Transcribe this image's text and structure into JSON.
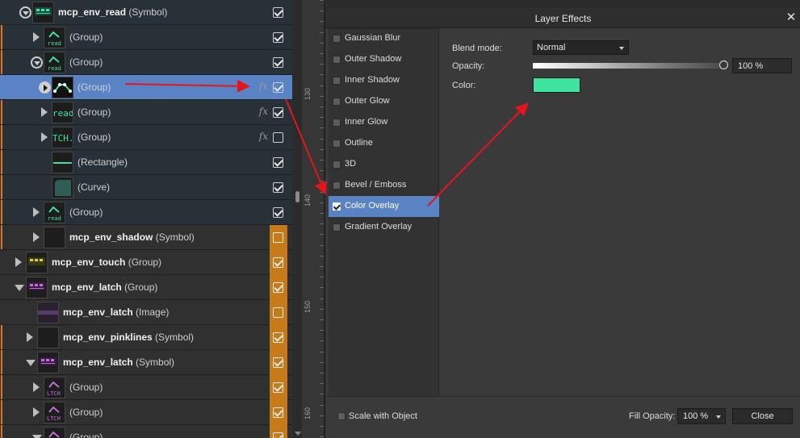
{
  "colors": {
    "accent": "#5a83c6",
    "orange": "#c77a1a",
    "overlay_color": "#3ee3a0",
    "arrow": "#e4161c"
  },
  "layers": [
    {
      "name": "mcp_env_read",
      "type": "(Symbol)",
      "bold": true,
      "expand": "circle-down",
      "checked": true,
      "fx": false,
      "indent": 24,
      "thumb": "read-symbol",
      "vis_orange": false,
      "bar": false
    },
    {
      "name": "",
      "type": "(Group)",
      "bold": false,
      "expand": "right",
      "checked": true,
      "fx": false,
      "indent": 38,
      "thumb": "read-icon",
      "vis_orange": false,
      "bar": true
    },
    {
      "name": "",
      "type": "(Group)",
      "bold": false,
      "expand": "circle-down",
      "checked": true,
      "fx": false,
      "indent": 38,
      "thumb": "read-icon",
      "vis_orange": false,
      "bar": true
    },
    {
      "name": "",
      "type": "(Group)",
      "bold": false,
      "expand": "circle-play",
      "checked": true,
      "fx": true,
      "indent": 48,
      "thumb": "caret-shape",
      "vis_orange": false,
      "bar": false,
      "selected": true
    },
    {
      "name": "",
      "type": "(Group)",
      "bold": false,
      "expand": "right",
      "checked": true,
      "fx": true,
      "indent": 48,
      "thumb": "read-text",
      "vis_orange": false,
      "bar": true
    },
    {
      "name": "",
      "type": "(Group)",
      "bold": false,
      "expand": "right",
      "checked": false,
      "fx": true,
      "indent": 48,
      "thumb": "tch-text",
      "vis_orange": false,
      "bar": true
    },
    {
      "name": "",
      "type": "(Rectangle)",
      "bold": false,
      "expand": "none",
      "checked": true,
      "fx": false,
      "indent": 48,
      "thumb": "line",
      "vis_orange": false,
      "bar": true
    },
    {
      "name": "",
      "type": "(Curve)",
      "bold": false,
      "expand": "none",
      "checked": true,
      "fx": false,
      "indent": 48,
      "thumb": "curve",
      "vis_orange": false,
      "bar": true
    },
    {
      "name": "",
      "type": "(Group)",
      "bold": false,
      "expand": "right",
      "checked": true,
      "fx": false,
      "indent": 38,
      "thumb": "read-icon",
      "vis_orange": false,
      "bar": true
    },
    {
      "name": "mcp_env_shadow",
      "type": "(Symbol)",
      "bold": true,
      "expand": "right",
      "checked": false,
      "fx": false,
      "indent": 38,
      "thumb": "blank",
      "vis_orange": true,
      "bar": true
    },
    {
      "name": "mcp_env_touch",
      "type": "(Group)",
      "bold": true,
      "expand": "right",
      "checked": true,
      "fx": false,
      "indent": 16,
      "thumb": "touch",
      "vis_orange": true,
      "bar": false
    },
    {
      "name": "mcp_env_latch",
      "type": "(Group)",
      "bold": true,
      "expand": "down",
      "checked": true,
      "fx": false,
      "indent": 16,
      "thumb": "latch",
      "vis_orange": true,
      "bar": false
    },
    {
      "name": "mcp_env_latch",
      "type": "(Image)",
      "bold": true,
      "expand": "none",
      "checked": false,
      "fx": false,
      "indent": 30,
      "thumb": "latch-image",
      "vis_orange": true,
      "bar": false
    },
    {
      "name": "mcp_env_pinklines",
      "type": "(Symbol)",
      "bold": true,
      "expand": "right",
      "checked": true,
      "fx": false,
      "indent": 30,
      "thumb": "blank",
      "vis_orange": true,
      "bar": true
    },
    {
      "name": "mcp_env_latch",
      "type": "(Symbol)",
      "bold": true,
      "expand": "down",
      "checked": true,
      "fx": false,
      "indent": 30,
      "thumb": "latch",
      "vis_orange": true,
      "bar": true
    },
    {
      "name": "",
      "type": "(Group)",
      "bold": false,
      "expand": "right",
      "checked": true,
      "fx": false,
      "indent": 38,
      "thumb": "ltch-icon",
      "vis_orange": true,
      "bar": true
    },
    {
      "name": "",
      "type": "(Group)",
      "bold": false,
      "expand": "right",
      "checked": true,
      "fx": false,
      "indent": 38,
      "thumb": "ltch-icon",
      "vis_orange": true,
      "bar": true
    },
    {
      "name": "",
      "type": "(Group)",
      "bold": false,
      "expand": "down",
      "checked": true,
      "fx": false,
      "indent": 38,
      "thumb": "ltch-icon",
      "vis_orange": true,
      "bar": true
    }
  ],
  "ruler": {
    "labels": [
      "130",
      "140",
      "150",
      "160"
    ]
  },
  "dialog": {
    "title": "Layer Effects",
    "close_glyph": "✕",
    "effects": [
      {
        "label": "Gaussian Blur",
        "checked": false
      },
      {
        "label": "Outer Shadow",
        "checked": false
      },
      {
        "label": "Inner Shadow",
        "checked": false
      },
      {
        "label": "Outer Glow",
        "checked": false
      },
      {
        "label": "Inner Glow",
        "checked": false
      },
      {
        "label": "Outline",
        "checked": false
      },
      {
        "label": "3D",
        "checked": false
      },
      {
        "label": "Bevel / Emboss",
        "checked": false
      },
      {
        "label": "Color Overlay",
        "checked": true,
        "selected": true
      },
      {
        "label": "Gradient Overlay",
        "checked": false
      }
    ],
    "blend_label": "Blend mode:",
    "blend_value": "Normal",
    "opacity_label": "Opacity:",
    "opacity_value": "100 %",
    "opacity_fraction": 1.0,
    "color_label": "Color:",
    "scale_label": "Scale with Object",
    "fill_opacity_label": "Fill Opacity:",
    "fill_opacity_value": "100 %",
    "close_label": "Close"
  },
  "icons": {
    "fx": "fx-icon",
    "expand": "expand-arrow-icon",
    "visibility": "visibility-checkbox-icon"
  }
}
